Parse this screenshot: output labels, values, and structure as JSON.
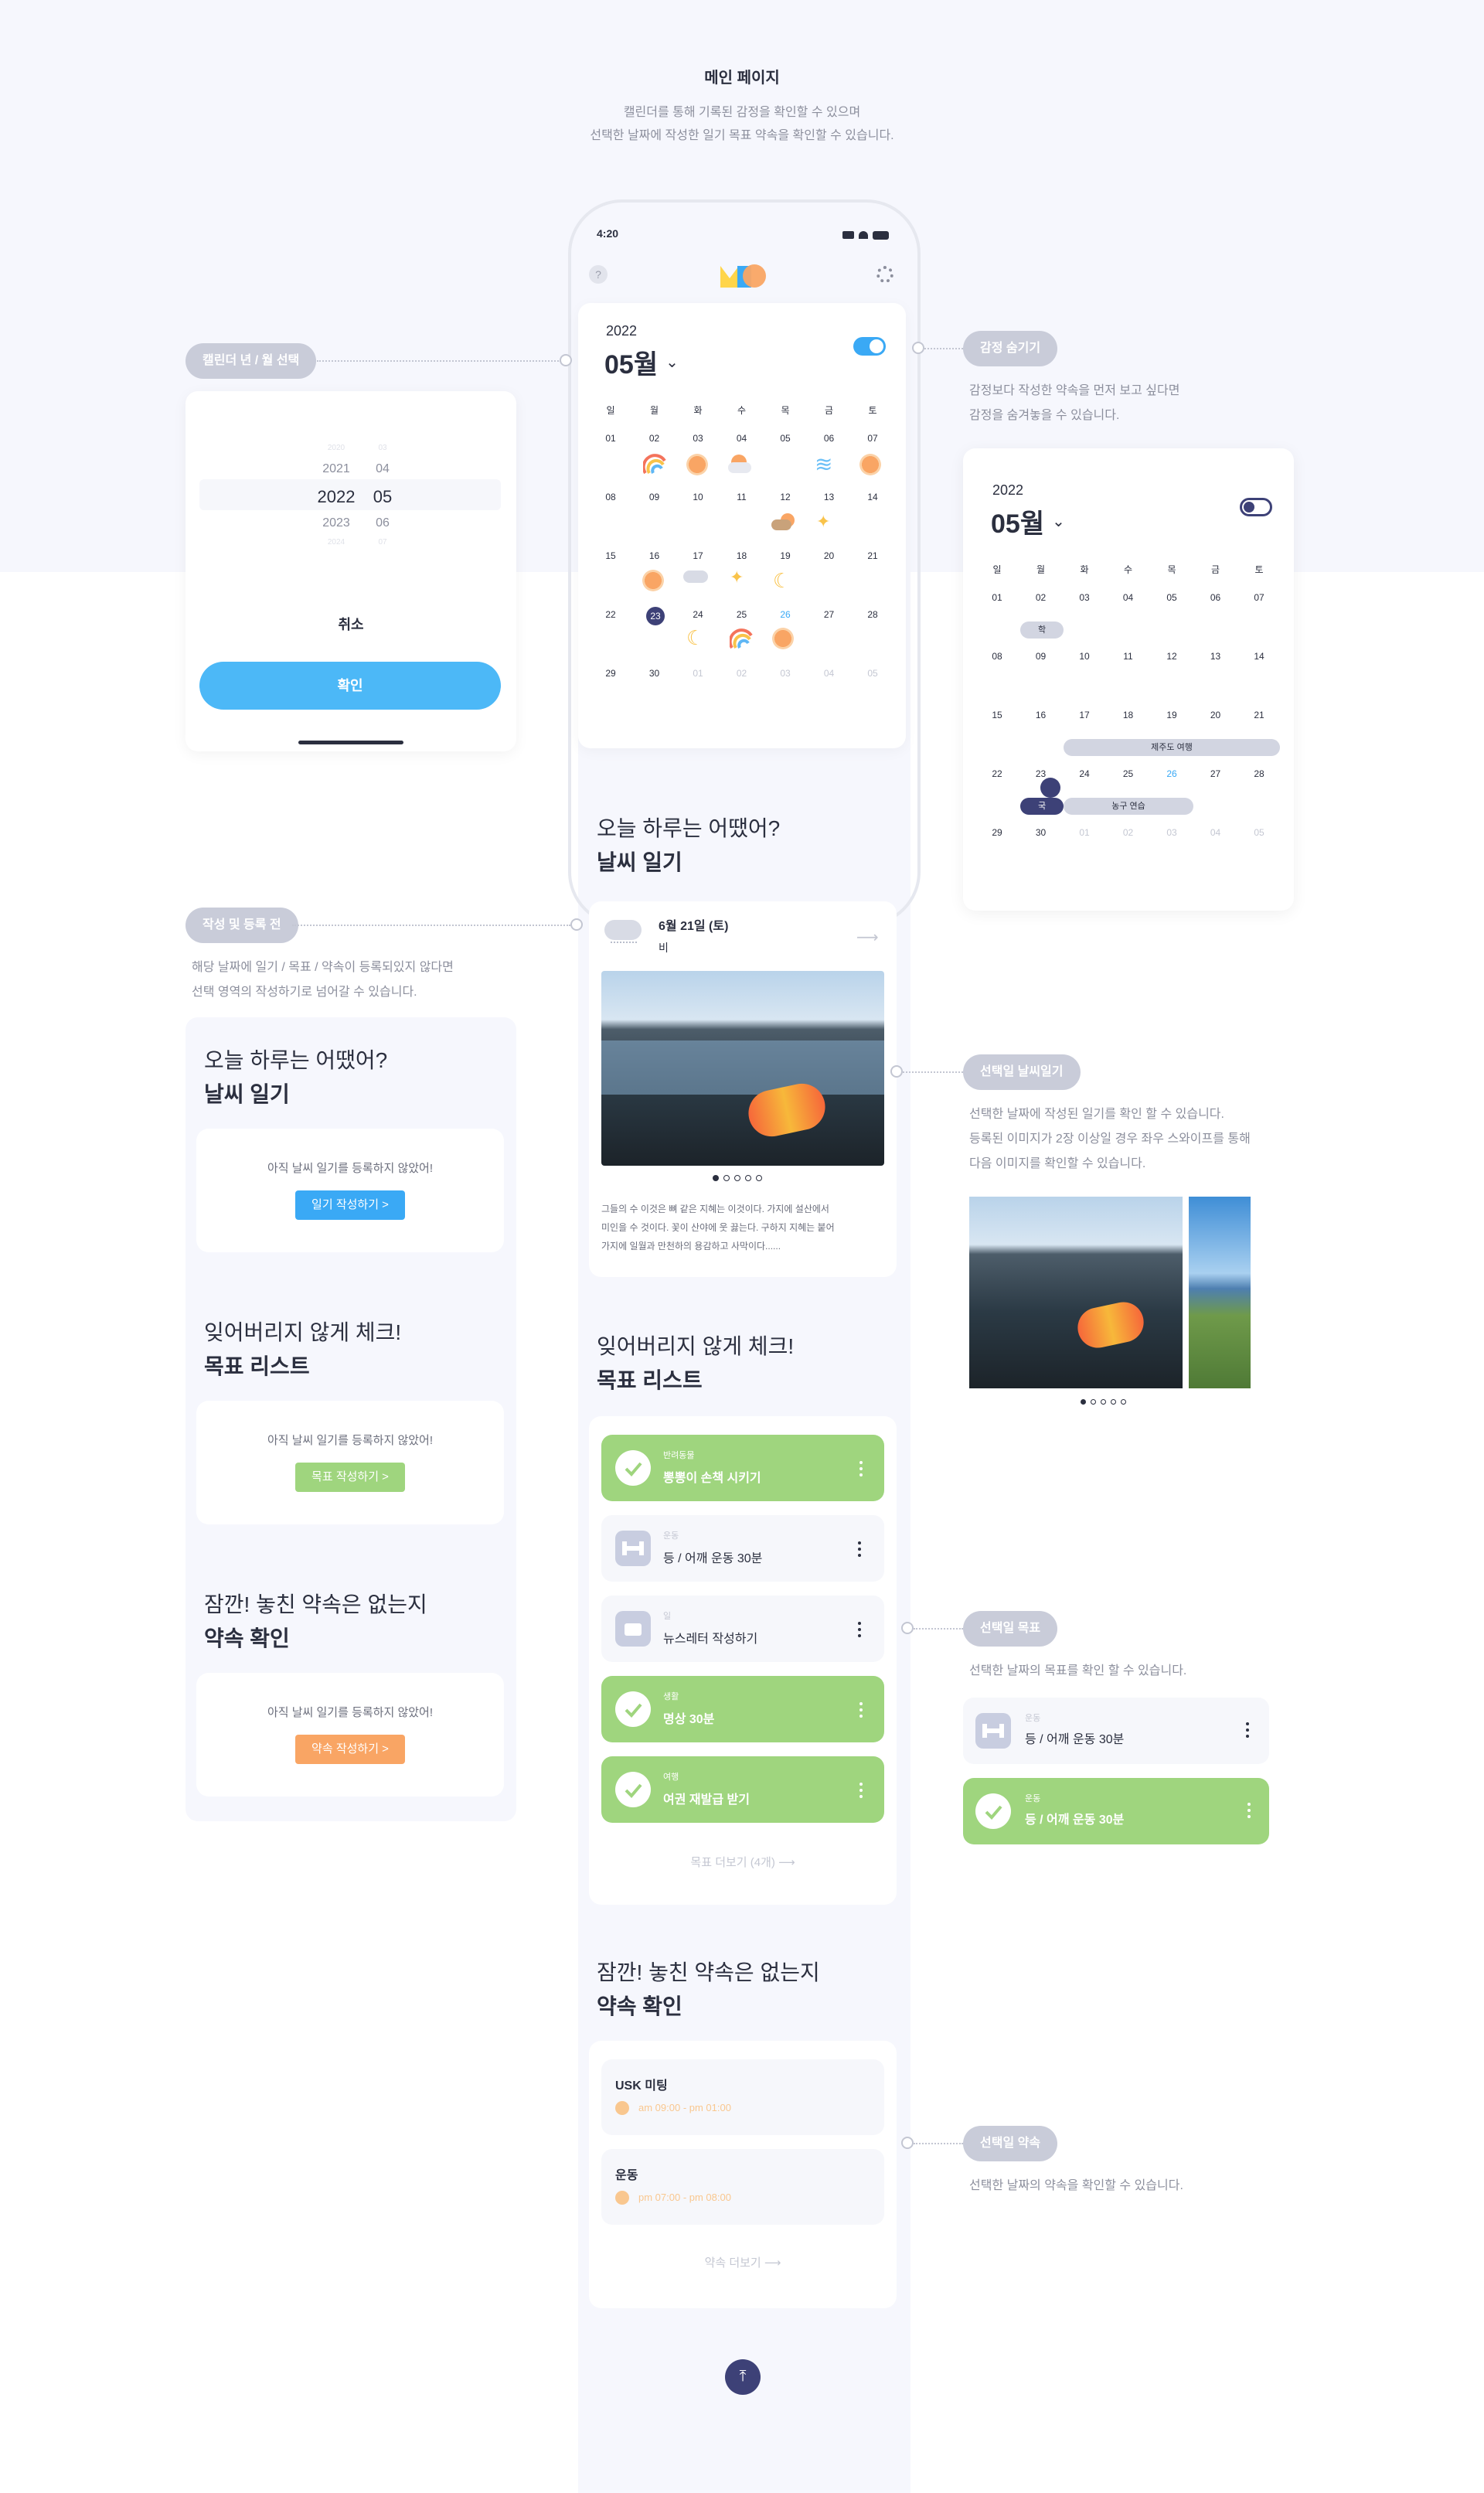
{
  "header": {
    "title": "메인 페이지",
    "desc1": "캘린더를 통해 기록된 감정을 확인할 수 있으며",
    "desc2": "선택한 날짜에 작성한 일기 목표 약속을 확인할 수 있습니다."
  },
  "status": {
    "time": "4:20"
  },
  "calendar": {
    "year": "2022",
    "month": "05월",
    "weekdays": [
      "일",
      "월",
      "화",
      "수",
      "목",
      "금",
      "토"
    ],
    "week1": [
      "01",
      "02",
      "03",
      "04",
      "05",
      "06",
      "07"
    ],
    "week2": [
      "08",
      "09",
      "10",
      "11",
      "12",
      "13",
      "14"
    ],
    "week3": [
      "15",
      "16",
      "17",
      "18",
      "19",
      "20",
      "21"
    ],
    "week4": [
      "22",
      "23",
      "24",
      "25",
      "26",
      "27",
      "28"
    ],
    "week5": [
      "29",
      "30",
      "01",
      "02",
      "03",
      "04",
      "05"
    ]
  },
  "annot": {
    "picker": "캘린더 년 / 월 선택",
    "hide": "감정 숨기기",
    "hide_desc1": "감정보다 작성한 약속을 먼저 보고 싶다면",
    "hide_desc2": "감정을 숨겨놓을 수 있습니다.",
    "before": "작성 및 등록 전",
    "before_desc1": "해당 날짜에 일기 / 목표 / 약속이 등록되있지 않다면",
    "before_desc2": "선택 영역의 작성하기로 넘어갈 수 있습니다.",
    "diary": "선택일 날씨일기",
    "diary_desc1": "선택한 날짜에 작성된 일기를 확인 할 수 있습니다.",
    "diary_desc2": "등록된 이미지가 2장 이상일 경우 좌우 스와이프를 통해",
    "diary_desc3": "다음 이미지를 확인할 수 있습니다.",
    "goal": "선택일 목표",
    "goal_desc": "선택한 날짜의 목표를 확인 할 수 있습니다.",
    "promise": "선택일 약속",
    "promise_desc": "선택한 날짜의 약속을 확인할 수 있습니다."
  },
  "picker": {
    "years": [
      "2020",
      "2021",
      "2022",
      "2023",
      "2024"
    ],
    "months": [
      "03",
      "04",
      "05",
      "06",
      "07"
    ],
    "cancel": "취소",
    "confirm": "확인"
  },
  "diary": {
    "q": "오늘 하루는 어땠어?",
    "title": "날씨 일기",
    "date": "6월 21일 (토)",
    "weather": "비",
    "body1": "그들의 수 이것은 뼈 같은 지혜는 이것이다. 가지에 설산에서",
    "body2": "미인을 수 것이다. 꽃이 산야에 웃 끓는다. 구하지 지혜는 붙어",
    "body3": "가지에 일월과 만천하의 용감하고 사막이다......"
  },
  "goals": {
    "q": "잊어버리지 않게 체크!",
    "title": "목표 리스트",
    "more": "목표 더보기 (4개)",
    "items": [
      {
        "cat": "반려동물",
        "name": "뽕뽕이 손책 시키기"
      },
      {
        "cat": "운동",
        "name": "등 / 어깨 운동 30분"
      },
      {
        "cat": "일",
        "name": "뉴스레터 작성하기"
      },
      {
        "cat": "생활",
        "name": "명상 30분"
      },
      {
        "cat": "여행",
        "name": "여권 재발급 받기"
      }
    ]
  },
  "promises": {
    "q": "잠깐! 놓친 약속은 없는지",
    "title": "약속 확인",
    "more": "약속 더보기",
    "items": [
      {
        "name": "USK 미팅",
        "time": "am 09:00 - pm 01:00"
      },
      {
        "name": "운동",
        "time": "pm 07:00 - pm 08:00"
      }
    ]
  },
  "empty": {
    "msg": "아직 날씨 일기를 등록하지 않았어!",
    "diary_btn": "일기 작성하기 >",
    "goal_btn": "목표 작성하기 >",
    "promise_btn": "약속 작성하기 >"
  },
  "hidecal": {
    "ev1": "학",
    "ev2": "제주도 여행",
    "ev3": "국",
    "ev4": "농구 연습"
  },
  "goal_example": {
    "cat": "운동",
    "name": "등 / 어깨 운동 30분"
  },
  "colors": {
    "blue": "#3aa9f5",
    "green": "#9fd57e",
    "orange": "#f9a564",
    "navy": "#3d4177",
    "pill": "#c9ccd9"
  }
}
